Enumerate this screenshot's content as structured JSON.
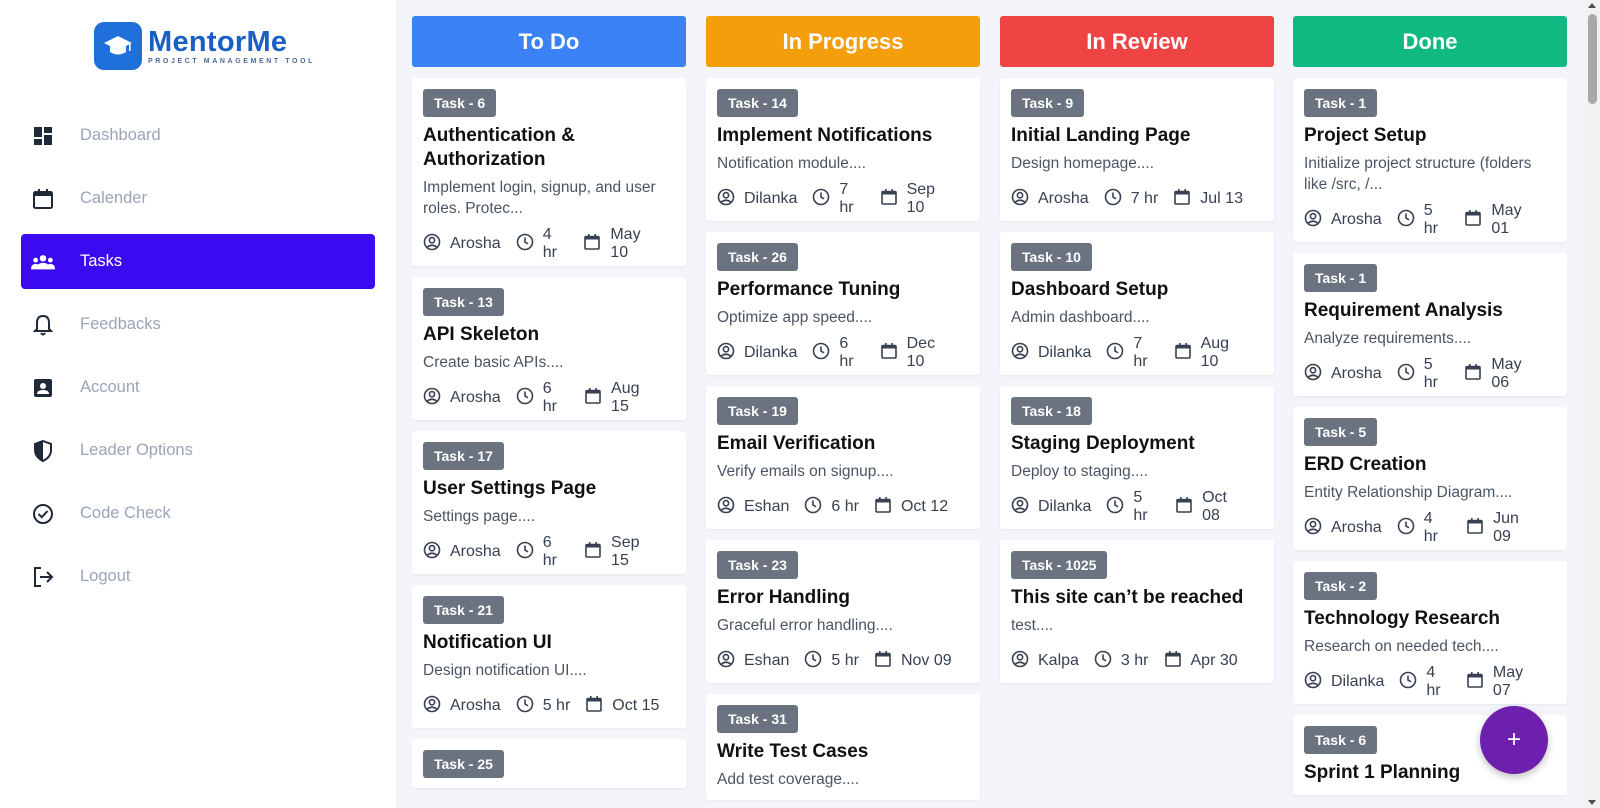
{
  "app": {
    "name": "MentorMe",
    "tagline": "PROJECT MANAGEMENT TOOL",
    "brand_color": "#1e6fd9"
  },
  "sidebar": {
    "items": [
      {
        "label": "Dashboard",
        "icon": "dashboard-icon",
        "active": false
      },
      {
        "label": "Calender",
        "icon": "calendar-icon",
        "active": false
      },
      {
        "label": "Tasks",
        "icon": "people-icon",
        "active": true
      },
      {
        "label": "Feedbacks",
        "icon": "bell-icon",
        "active": false
      },
      {
        "label": "Account",
        "icon": "account-box-icon",
        "active": false
      },
      {
        "label": "Leader Options",
        "icon": "shield-icon",
        "active": false
      },
      {
        "label": "Code Check",
        "icon": "check-circle-icon",
        "active": false
      },
      {
        "label": "Logout",
        "icon": "logout-icon",
        "active": false
      }
    ],
    "active_color": "#3b0af0"
  },
  "board": {
    "columns": [
      {
        "title": "To Do",
        "color": "#3b82f6",
        "cards": [
          {
            "tag": "Task - 6",
            "title": "Authentication & Authorization",
            "desc": "Implement login, signup, and user roles. Protec...",
            "assignee": "Arosha",
            "hours": "4 hr",
            "date": "May 10"
          },
          {
            "tag": "Task - 13",
            "title": "API Skeleton",
            "desc": "Create basic APIs....",
            "assignee": "Arosha",
            "hours": "6 hr",
            "date": "Aug 15"
          },
          {
            "tag": "Task - 17",
            "title": "User Settings Page",
            "desc": "Settings page....",
            "assignee": "Arosha",
            "hours": "6 hr",
            "date": "Sep 15"
          },
          {
            "tag": "Task - 21",
            "title": "Notification UI",
            "desc": "Design notification UI....",
            "assignee": "Arosha",
            "hours": "5 hr",
            "date": "Oct 15"
          },
          {
            "tag": "Task - 25",
            "title": "",
            "desc": "",
            "assignee": "",
            "hours": "",
            "date": ""
          }
        ]
      },
      {
        "title": "In Progress",
        "color": "#f59e0b",
        "cards": [
          {
            "tag": "Task - 14",
            "title": "Implement Notifications",
            "desc": "Notification module....",
            "assignee": "Dilanka",
            "hours": "7 hr",
            "date": "Sep 10"
          },
          {
            "tag": "Task - 26",
            "title": "Performance Tuning",
            "desc": "Optimize app speed....",
            "assignee": "Dilanka",
            "hours": "6 hr",
            "date": "Dec 10"
          },
          {
            "tag": "Task - 19",
            "title": "Email Verification",
            "desc": "Verify emails on signup....",
            "assignee": "Eshan",
            "hours": "6 hr",
            "date": "Oct 12"
          },
          {
            "tag": "Task - 23",
            "title": "Error Handling",
            "desc": "Graceful error handling....",
            "assignee": "Eshan",
            "hours": "5 hr",
            "date": "Nov 09"
          },
          {
            "tag": "Task - 31",
            "title": "Write Test Cases",
            "desc": "Add test coverage....",
            "assignee": "",
            "hours": "",
            "date": ""
          }
        ]
      },
      {
        "title": "In Review",
        "color": "#ef4444",
        "cards": [
          {
            "tag": "Task - 9",
            "title": "Initial Landing Page",
            "desc": "Design homepage....",
            "assignee": "Arosha",
            "hours": "7 hr",
            "date": "Jul 13"
          },
          {
            "tag": "Task - 10",
            "title": "Dashboard Setup",
            "desc": "Admin dashboard....",
            "assignee": "Dilanka",
            "hours": "7 hr",
            "date": "Aug 10"
          },
          {
            "tag": "Task - 18",
            "title": "Staging Deployment",
            "desc": "Deploy to staging....",
            "assignee": "Dilanka",
            "hours": "5 hr",
            "date": "Oct 08"
          },
          {
            "tag": "Task - 1025",
            "title": "This site can’t be reached",
            "desc": "test....",
            "assignee": "Kalpa",
            "hours": "3 hr",
            "date": "Apr 30"
          }
        ]
      },
      {
        "title": "Done",
        "color": "#10b981",
        "cards": [
          {
            "tag": "Task - 1",
            "title": "Project Setup",
            "desc": "Initialize project structure (folders like /src, /...",
            "assignee": "Arosha",
            "hours": "5 hr",
            "date": "May 01"
          },
          {
            "tag": "Task - 1",
            "title": "Requirement Analysis",
            "desc": "Analyze requirements....",
            "assignee": "Arosha",
            "hours": "5 hr",
            "date": "May 06"
          },
          {
            "tag": "Task - 5",
            "title": "ERD Creation",
            "desc": "Entity Relationship Diagram....",
            "assignee": "Arosha",
            "hours": "4 hr",
            "date": "Jun 09"
          },
          {
            "tag": "Task - 2",
            "title": "Technology Research",
            "desc": "Research on needed tech....",
            "assignee": "Dilanka",
            "hours": "4 hr",
            "date": "May 07"
          },
          {
            "tag": "Task - 6",
            "title": "Sprint 1 Planning",
            "desc": "",
            "assignee": "",
            "hours": "",
            "date": ""
          }
        ]
      }
    ]
  },
  "fab": {
    "label": "+",
    "color": "#6d1fae"
  }
}
